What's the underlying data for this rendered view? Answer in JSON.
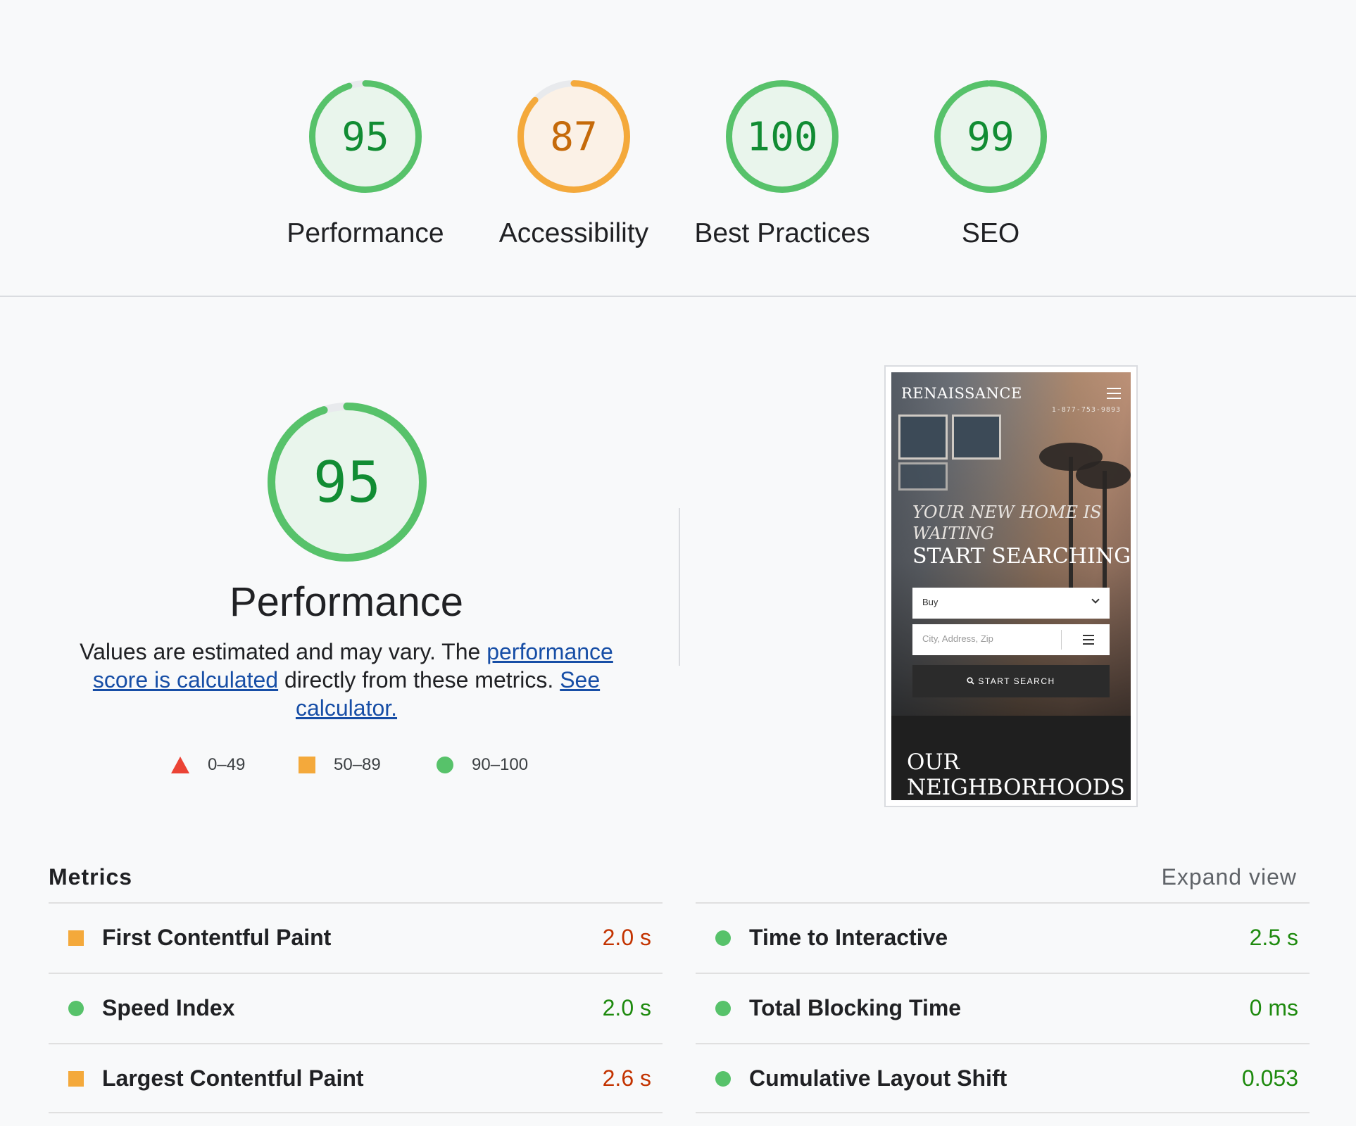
{
  "categories": [
    {
      "score": "95",
      "label": "Performance",
      "fraction": 0.95,
      "status": "pass"
    },
    {
      "score": "87",
      "label": "Accessibility",
      "fraction": 0.87,
      "status": "average"
    },
    {
      "score": "100",
      "label": "Best Practices",
      "fraction": 1.0,
      "status": "pass"
    },
    {
      "score": "99",
      "label": "SEO",
      "fraction": 0.99,
      "status": "pass"
    }
  ],
  "performance": {
    "score": "95",
    "fraction": 0.95,
    "title": "Performance",
    "desc_part1": "Values are estimated and may vary. The ",
    "link1": "performance score is calculated",
    "desc_part2": " directly from these metrics. ",
    "link2": "See calculator."
  },
  "legend": [
    {
      "shape": "triangle",
      "range": "0–49",
      "color": "#eb4335"
    },
    {
      "shape": "square",
      "range": "50–89",
      "color": "#f4a93b"
    },
    {
      "shape": "circle",
      "range": "90–100",
      "color": "#57c26a"
    }
  ],
  "colors": {
    "pass": "#57c26a",
    "pass_bg": "#e9f5ec",
    "pass_text": "#118c33",
    "average": "#f4a93b",
    "average_bg": "#fbf1e6",
    "average_text": "#c56a0a",
    "track": "#e8eaed"
  },
  "screenshot": {
    "logo": "RENAISSANCE",
    "phone": "1-877-753-9893",
    "tagline": "YOUR NEW HOME IS WAITING",
    "heading": "START SEARCHING",
    "select_value": "Buy",
    "input_placeholder": "City, Address, Zip",
    "button_label": "START SEARCH",
    "section_heading": "OUR NEIGHBORHOODS",
    "icons": [
      "menu-icon",
      "chevron-down-icon",
      "filter-icon",
      "search-icon"
    ]
  },
  "metrics": {
    "title": "Metrics",
    "expand_label": "Expand view",
    "left": [
      {
        "name": "First Contentful Paint",
        "value": "2.0 s",
        "status": "average"
      },
      {
        "name": "Speed Index",
        "value": "2.0 s",
        "status": "pass"
      },
      {
        "name": "Largest Contentful Paint",
        "value": "2.6 s",
        "status": "average"
      }
    ],
    "right": [
      {
        "name": "Time to Interactive",
        "value": "2.5 s",
        "status": "pass"
      },
      {
        "name": "Total Blocking Time",
        "value": "0 ms",
        "status": "pass"
      },
      {
        "name": "Cumulative Layout Shift",
        "value": "0.053",
        "status": "pass"
      }
    ]
  }
}
